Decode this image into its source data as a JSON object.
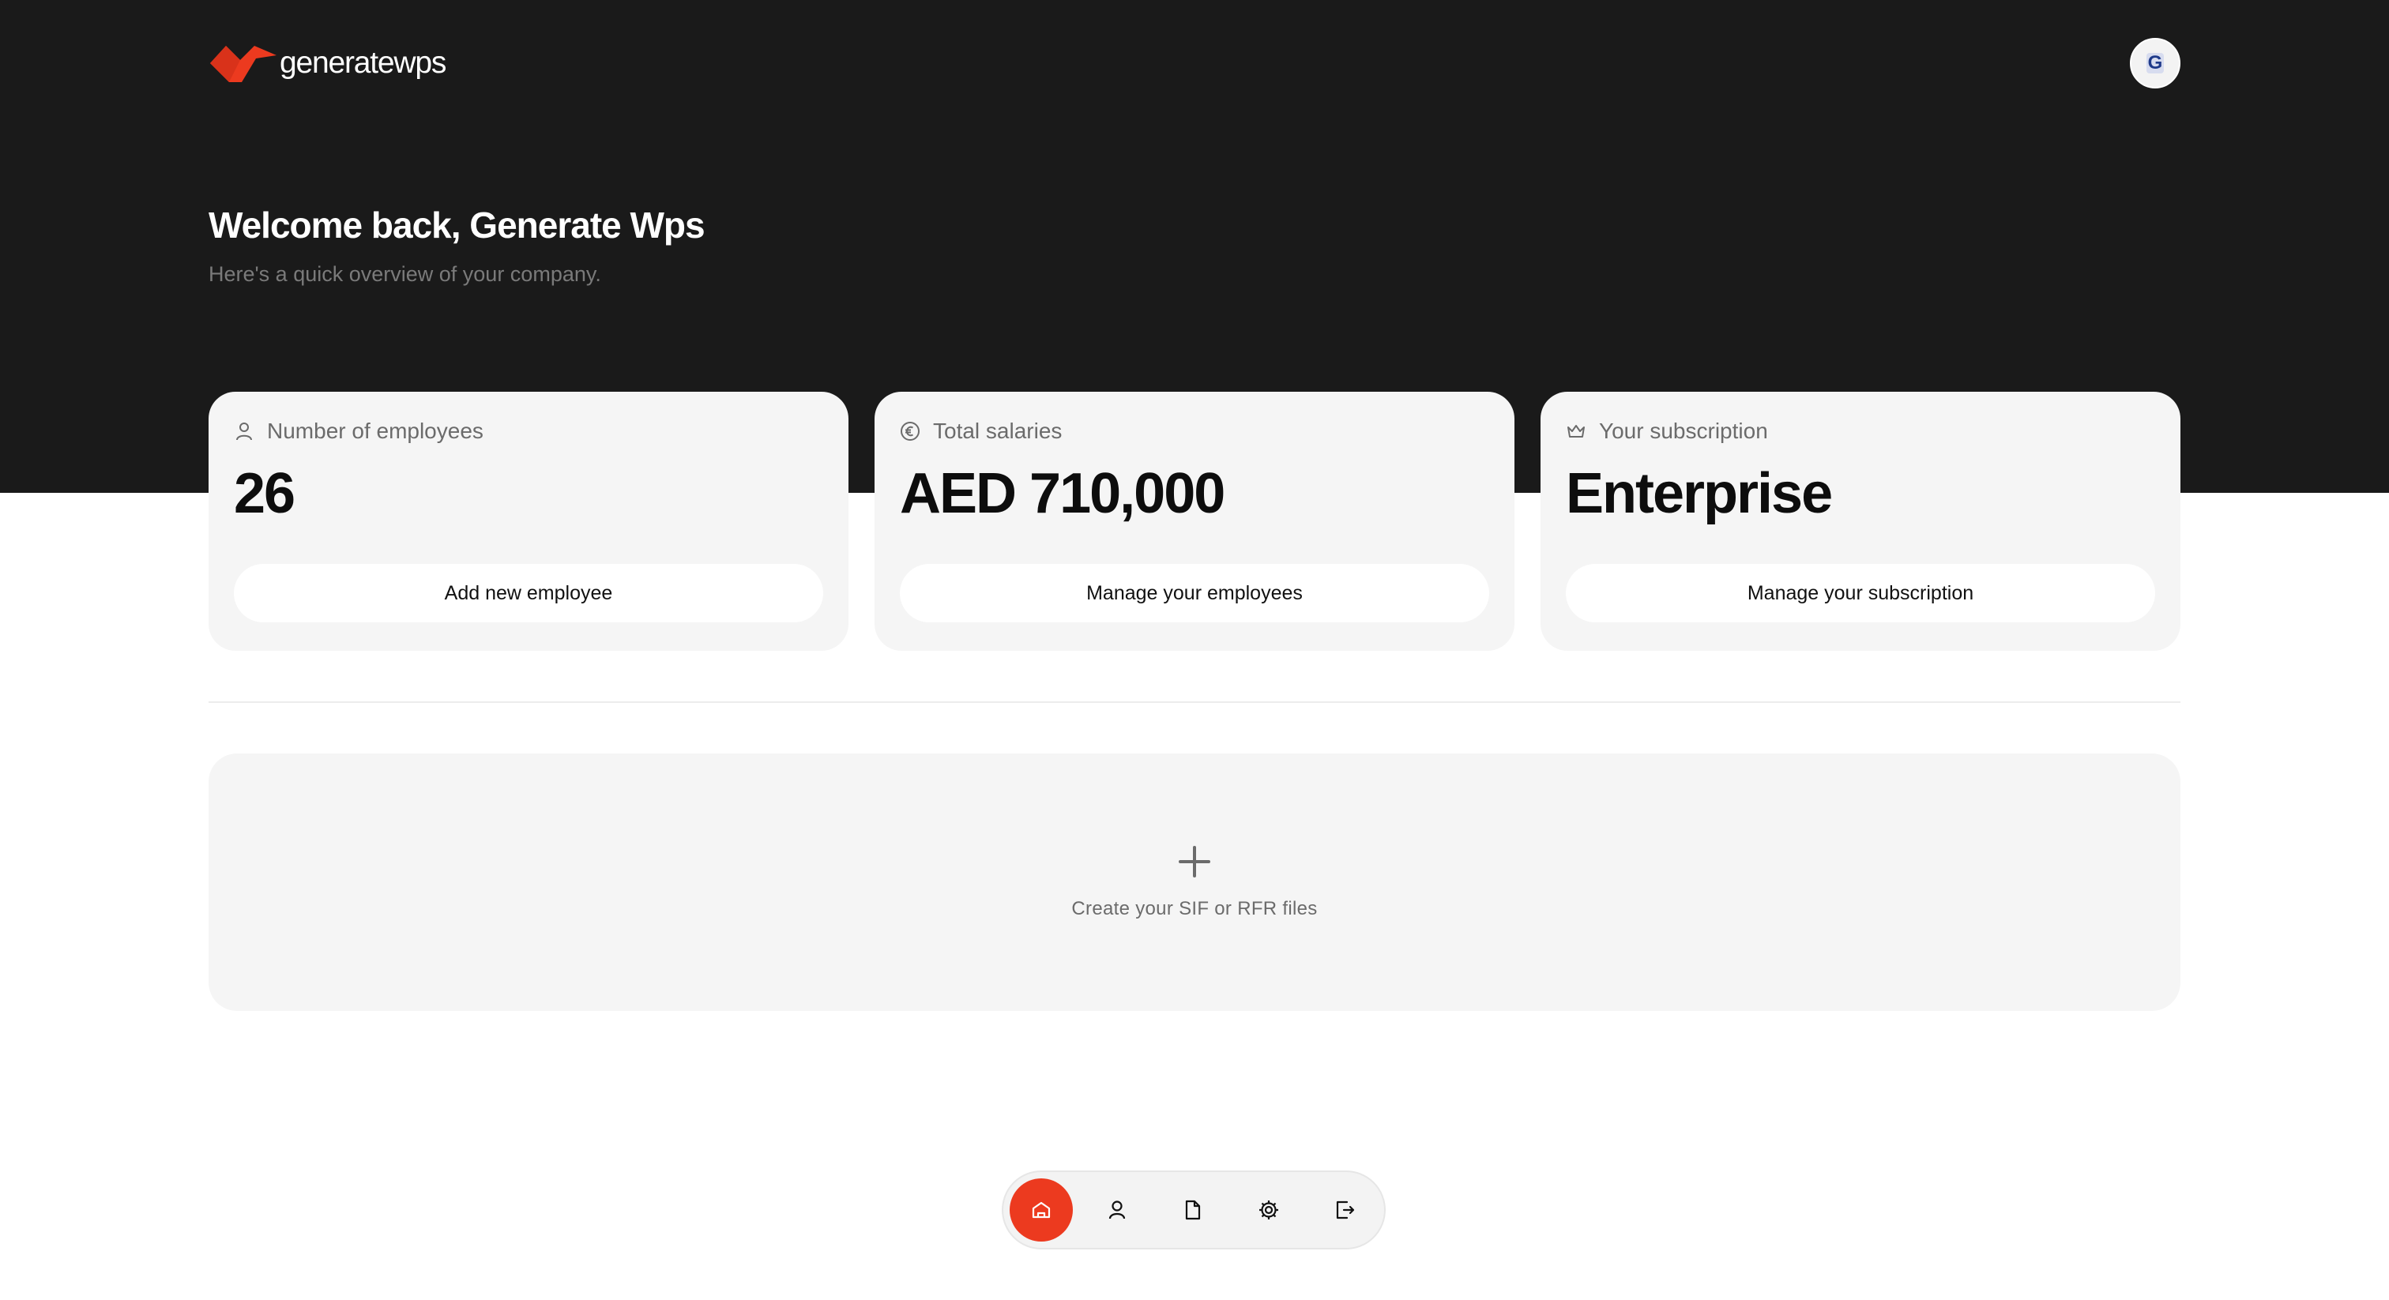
{
  "brand": {
    "name": "generatewps",
    "accent_color": "#ec3a1f",
    "logo_icon": "wing-logo-icon"
  },
  "user": {
    "avatar_initial": "G"
  },
  "header": {
    "welcome": "Welcome back, Generate Wps",
    "subtitle": "Here's a quick overview of your company."
  },
  "cards": [
    {
      "icon": "user-icon",
      "label": "Number of employees",
      "value": "26",
      "button": "Add new employee"
    },
    {
      "icon": "euro-circle-icon",
      "label": "Total salaries",
      "value": "AED 710,000",
      "button": "Manage your employees"
    },
    {
      "icon": "crown-icon",
      "label": "Your subscription",
      "value": "Enterprise",
      "button": "Manage your subscription"
    }
  ],
  "create_panel": {
    "icon": "plus-icon",
    "label": "Create your SIF or RFR files"
  },
  "dock": {
    "items": [
      {
        "icon": "home-icon",
        "active": true
      },
      {
        "icon": "user-icon",
        "active": false
      },
      {
        "icon": "file-icon",
        "active": false
      },
      {
        "icon": "gear-icon",
        "active": false
      },
      {
        "icon": "logout-icon",
        "active": false
      }
    ]
  }
}
